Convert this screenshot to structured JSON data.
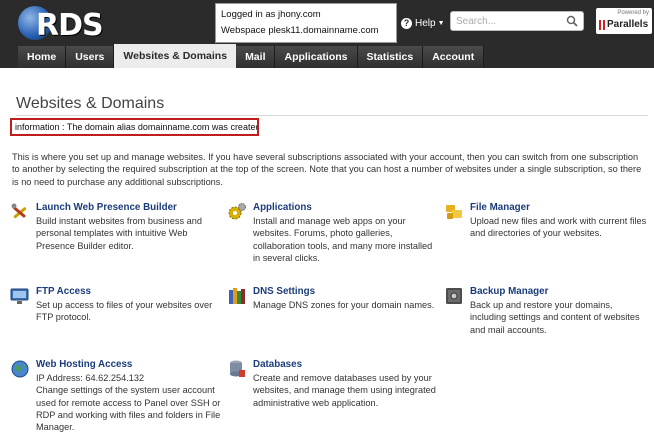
{
  "header": {
    "logo_text": "RDS",
    "login": {
      "logged_in_as": "Logged in as jhony.com",
      "webspace": "Webspace plesk11.domainname.com"
    },
    "help_label": "Help",
    "search_placeholder": "Search...",
    "powered_by": "Powered by",
    "brand": "Parallels"
  },
  "tabs": [
    {
      "label": "Home",
      "active": false
    },
    {
      "label": "Users",
      "active": false
    },
    {
      "label": "Websites & Domains",
      "active": true
    },
    {
      "label": "Mail",
      "active": false
    },
    {
      "label": "Applications",
      "active": false
    },
    {
      "label": "Statistics",
      "active": false
    },
    {
      "label": "Account",
      "active": false
    }
  ],
  "page": {
    "title": "Websites & Domains",
    "info_message": "information : The domain alias domainname.com was created",
    "intro": "This is where you set up and manage websites. If you have several subscriptions associated with your account, then you can switch from one subscription to another by selecting the required subscription at the top of the screen. Note that you can host a number of websites under a single subscription, so there is no need to purchase any additional subscriptions."
  },
  "services": [
    {
      "title": "Launch Web Presence Builder",
      "desc": "Build instant websites from business and personal templates with intuitive Web Presence Builder editor.",
      "icon": "tools-icon"
    },
    {
      "title": "Applications",
      "desc": "Install and manage web apps on your websites. Forums, photo galleries, collaboration tools, and many more installed in several clicks.",
      "icon": "gears-icon"
    },
    {
      "title": "File Manager",
      "desc": "Upload new files and work with current files and directories of your websites.",
      "icon": "folders-icon"
    },
    {
      "title": "FTP Access",
      "desc": "Set up access to files of your websites over FTP protocol.",
      "icon": "ftp-monitor-icon"
    },
    {
      "title": "DNS Settings",
      "desc": "Manage DNS zones for your domain names.",
      "icon": "books-icon"
    },
    {
      "title": "Backup Manager",
      "desc": "Back up and restore your domains, including settings and content of websites and mail accounts.",
      "icon": "safe-icon"
    },
    {
      "title": "Web Hosting Access",
      "desc": "IP Address: 64.62.254.132\nChange settings of the system user account used for remote access to Panel over SSH or RDP and working with files and folders in File Manager.",
      "icon": "globe-icon"
    },
    {
      "title": "Databases",
      "desc": "Create and remove databases used by your websites, and manage them using integrated administrative web application.",
      "icon": "database-icon"
    }
  ],
  "colors": {
    "header_bg": "#2b2b2b",
    "link_title": "#1b3c7a",
    "info_border": "#c11d1d"
  }
}
